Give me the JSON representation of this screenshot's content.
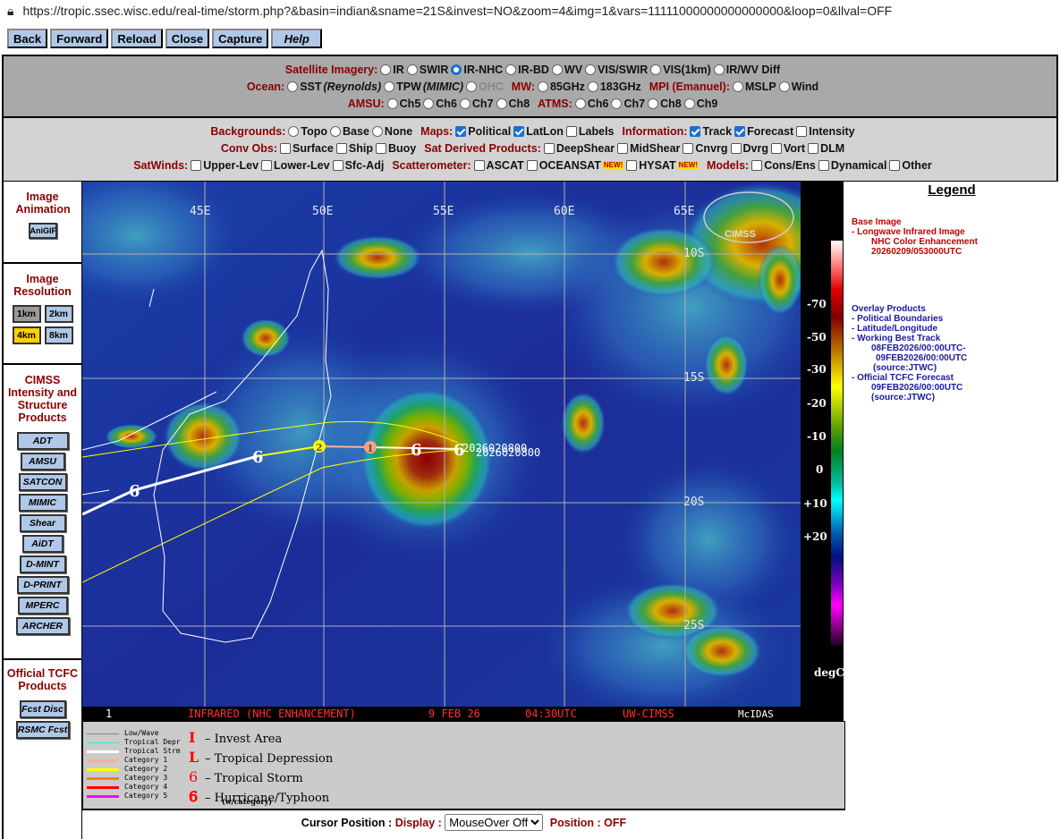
{
  "browser": {
    "url": "https://tropic.ssec.wisc.edu/real-time/storm.php?&basin=indian&sname=21S&invest=NO&zoom=4&img=1&vars=11111000000000000000&loop=0&llval=OFF"
  },
  "toolbar": [
    "Back",
    "Forward",
    "Reload",
    "Close",
    "Capture",
    "Help"
  ],
  "panel1": [
    [
      {
        "label": "Satellite Imagery:",
        "items": [
          {
            "t": "IR",
            "k": "radio"
          },
          {
            "t": "SWIR",
            "k": "radio"
          },
          {
            "t": "IR-NHC",
            "k": "radio",
            "on": true
          },
          {
            "t": "IR-BD",
            "k": "radio"
          },
          {
            "t": "WV",
            "k": "radio"
          },
          {
            "t": "VIS/SWIR",
            "k": "radio"
          },
          {
            "t": "VIS(1km)",
            "k": "radio"
          },
          {
            "t": "IR/WV Diff",
            "k": "radio"
          }
        ]
      }
    ],
    [
      {
        "label": "Ocean:",
        "items": [
          {
            "t": "SST",
            "i": "(Reynolds)",
            "k": "radio"
          },
          {
            "t": "TPW",
            "i": "(MIMIC)",
            "k": "radio"
          },
          {
            "t": "OHC",
            "k": "radio",
            "dis": true
          }
        ]
      },
      {
        "label": "MW:",
        "items": [
          {
            "t": "85GHz",
            "k": "radio"
          },
          {
            "t": "183GHz",
            "k": "radio"
          }
        ]
      },
      {
        "label": "MPI (Emanuel):",
        "items": [
          {
            "t": "MSLP",
            "k": "radio"
          },
          {
            "t": "Wind",
            "k": "radio"
          }
        ]
      }
    ],
    [
      {
        "label": "AMSU:",
        "items": [
          {
            "t": "Ch5",
            "k": "radio"
          },
          {
            "t": "Ch6",
            "k": "radio"
          },
          {
            "t": "Ch7",
            "k": "radio"
          },
          {
            "t": "Ch8",
            "k": "radio"
          }
        ]
      },
      {
        "label": "ATMS:",
        "items": [
          {
            "t": "Ch6",
            "k": "radio"
          },
          {
            "t": "Ch7",
            "k": "radio"
          },
          {
            "t": "Ch8",
            "k": "radio"
          },
          {
            "t": "Ch9",
            "k": "radio"
          }
        ]
      }
    ]
  ],
  "panel2": [
    [
      {
        "label": "Backgrounds:",
        "items": [
          {
            "t": "Topo",
            "k": "radio"
          },
          {
            "t": "Base",
            "k": "radio"
          },
          {
            "t": "None",
            "k": "radio"
          }
        ]
      },
      {
        "label": "Maps:",
        "items": [
          {
            "t": "Political",
            "k": "chk",
            "on": true
          },
          {
            "t": "LatLon",
            "k": "chk",
            "on": true
          },
          {
            "t": "Labels",
            "k": "chk"
          }
        ]
      },
      {
        "label": "Information:",
        "items": [
          {
            "t": "Track",
            "k": "chk",
            "on": true
          },
          {
            "t": "Forecast",
            "k": "chk",
            "on": true
          },
          {
            "t": "Intensity",
            "k": "chk"
          }
        ]
      }
    ],
    [
      {
        "label": "Conv Obs:",
        "items": [
          {
            "t": "Surface",
            "k": "chk"
          },
          {
            "t": "Ship",
            "k": "chk"
          },
          {
            "t": "Buoy",
            "k": "chk"
          }
        ]
      },
      {
        "label": "Sat Derived Products:",
        "items": [
          {
            "t": "DeepShear",
            "k": "chk"
          },
          {
            "t": "MidShear",
            "k": "chk"
          },
          {
            "t": "Cnvrg",
            "k": "chk"
          },
          {
            "t": "Dvrg",
            "k": "chk"
          },
          {
            "t": "Vort",
            "k": "chk"
          },
          {
            "t": "DLM",
            "k": "chk"
          }
        ]
      }
    ],
    [
      {
        "label": "SatWinds:",
        "items": [
          {
            "t": "Upper-Lev",
            "k": "chk"
          },
          {
            "t": "Lower-Lev",
            "k": "chk"
          },
          {
            "t": "Sfc-Adj",
            "k": "chk"
          }
        ]
      },
      {
        "label": "Scatterometer:",
        "items": [
          {
            "t": "ASCAT",
            "k": "chk"
          },
          {
            "t": "OCEANSAT",
            "k": "chk",
            "new": "NEW!"
          },
          {
            "t": "HYSAT",
            "k": "chk",
            "new": "NEW!"
          }
        ]
      },
      {
        "label": "Models:",
        "items": [
          {
            "t": "Cons/Ens",
            "k": "chk"
          },
          {
            "t": "Dynamical",
            "k": "chk"
          },
          {
            "t": "Other",
            "k": "chk"
          }
        ]
      }
    ]
  ],
  "sidebar": {
    "animation_title": "Image Animation",
    "anigif": "AniGIF",
    "resolution_title": "Image Resolution",
    "res": [
      "1km",
      "2km",
      "4km",
      "8km"
    ],
    "res_selected": "4km",
    "cimss_title": "CIMSS Intensity and Structure Products",
    "cimss": [
      "ADT",
      "AMSU",
      "SATCON",
      "MIMIC",
      "Shear",
      "AiDT",
      "D-MINT",
      "D-PRINT",
      "MPERC",
      "ARCHER"
    ],
    "tcfc_title": "Official TCFC Products",
    "tcfc": [
      "Fcst Disc",
      "RSMC Fcst"
    ]
  },
  "image": {
    "lon_labels": [
      "45E",
      "50E",
      "55E",
      "60E",
      "65E"
    ],
    "lat_labels": [
      "10S",
      "15S",
      "20S",
      "25S"
    ],
    "track_labels": [
      "2026020800",
      "2026020800"
    ],
    "intensity_markers": [
      "2",
      "1"
    ],
    "footer": {
      "frame": "1",
      "product": "INFRARED (NHC ENHANCEMENT)",
      "date": "9 FEB 26",
      "time": "04:30UTC",
      "source": "UW-CIMSS",
      "system": "McIDAS"
    },
    "logo": "CIMSS"
  },
  "colorbar": {
    "ticks": [
      "-70",
      "-50",
      "-30",
      "-20",
      "-10",
      "0",
      "+10",
      "+20"
    ],
    "unit": "degC"
  },
  "legend": {
    "title": "Legend",
    "base": [
      "Base Image",
      "-   Longwave Infrared Image",
      "NHC Color Enhancement",
      "20260209/053000UTC"
    ],
    "overlay": [
      "Overlay Products",
      "-  Political Boundaries",
      "-  Latitude/Longitude",
      "-  Working Best Track",
      "08FEB2026/00:00UTC-",
      "09FEB2026/00:00UTC",
      "(source:JTWC)",
      "-  Official TCFC Forecast",
      "09FEB2026/00:00UTC",
      "(source:JTWC)"
    ]
  },
  "track_legend": {
    "lines": [
      {
        "t": "Low/Wave",
        "c": "#888888"
      },
      {
        "t": "Tropical Depr",
        "c": "#40e0e0"
      },
      {
        "t": "Tropical Strm",
        "c": "#ffffff"
      },
      {
        "t": "Category 1",
        "c": "#ffb090"
      },
      {
        "t": "Category 2",
        "c": "#ffff00"
      },
      {
        "t": "Category 3",
        "c": "#ff8000"
      },
      {
        "t": "Category 4",
        "c": "#ff0000"
      },
      {
        "t": "Category 5",
        "c": "#ff00ff"
      }
    ],
    "symbols": [
      {
        "s": "I",
        "t": "– Invest Area"
      },
      {
        "s": "L",
        "t": "– Tropical Depression"
      },
      {
        "s": "6",
        "t": "– Tropical Storm"
      },
      {
        "s": "6",
        "t": "– Hurricane/Typhoon"
      }
    ],
    "note": "(w/category)"
  },
  "cursor": {
    "label": "Cursor Position :",
    "display": "Display :",
    "select": "MouseOver Off",
    "position": "Position : OFF"
  }
}
